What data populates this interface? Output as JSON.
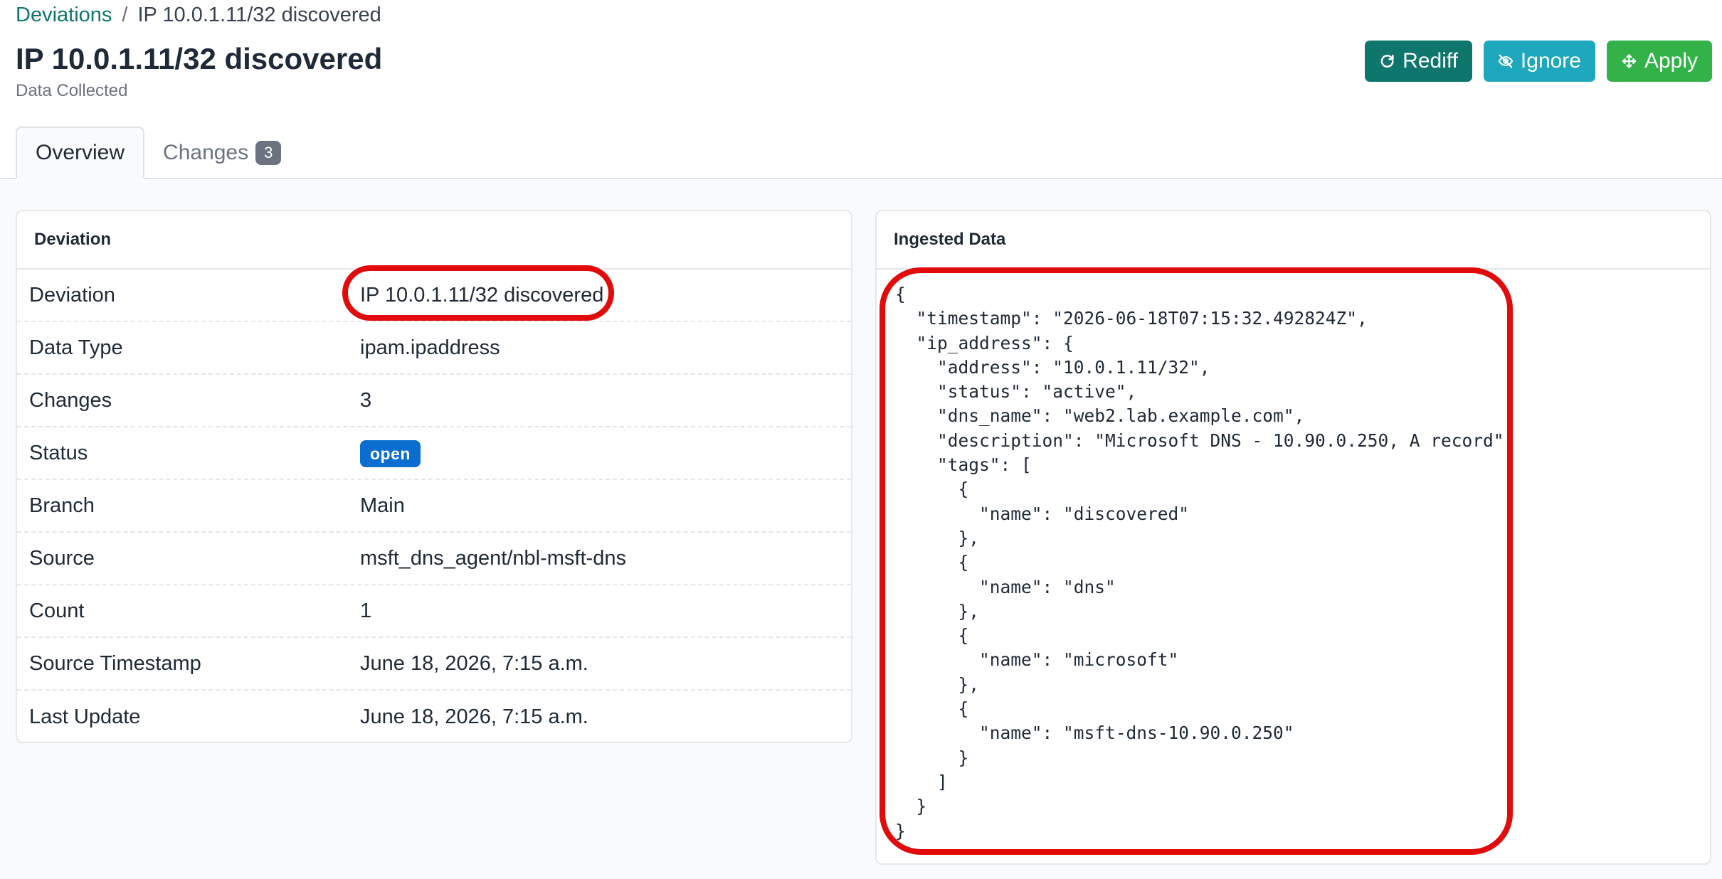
{
  "breadcrumb": {
    "parent": "Deviations",
    "separator": "/",
    "current": "IP 10.0.1.11/32 discovered"
  },
  "header": {
    "title": "IP 10.0.1.11/32 discovered",
    "subtitle": "Data Collected"
  },
  "actions": {
    "rediff": "Rediff",
    "ignore": "Ignore",
    "apply": "Apply"
  },
  "tabs": [
    {
      "label": "Overview",
      "active": true
    },
    {
      "label": "Changes",
      "count": "3"
    }
  ],
  "deviation_card": {
    "title": "Deviation",
    "rows": [
      {
        "label": "Deviation",
        "value": "IP 10.0.1.11/32 discovered"
      },
      {
        "label": "Data Type",
        "value": "ipam.ipaddress"
      },
      {
        "label": "Changes",
        "value": "3"
      },
      {
        "label": "Status",
        "value": "open"
      },
      {
        "label": "Branch",
        "value": "Main"
      },
      {
        "label": "Source",
        "value": "msft_dns_agent/nbl-msft-dns"
      },
      {
        "label": "Count",
        "value": "1"
      },
      {
        "label": "Source Timestamp",
        "value": "June 18, 2026, 7:15 a.m."
      },
      {
        "label": "Last Update",
        "value": "June 18, 2026, 7:15 a.m."
      }
    ]
  },
  "ingested_card": {
    "title": "Ingested Data",
    "json_text": "{\n  \"timestamp\": \"2026-06-18T07:15:32.492824Z\",\n  \"ip_address\": {\n    \"address\": \"10.0.1.11/32\",\n    \"status\": \"active\",\n    \"dns_name\": \"web2.lab.example.com\",\n    \"description\": \"Microsoft DNS - 10.90.0.250, A record\",\n    \"tags\": [\n      {\n        \"name\": \"discovered\"\n      },\n      {\n        \"name\": \"dns\"\n      },\n      {\n        \"name\": \"microsoft\"\n      },\n      {\n        \"name\": \"msft-dns-10.90.0.250\"\n      }\n    ]\n  }\n}"
  },
  "colors": {
    "accent": "#0f766e",
    "ignore": "#1ea8bd",
    "apply": "#33b24a",
    "status_open": "#0b6dcf",
    "annotation": "#e10b0b"
  }
}
